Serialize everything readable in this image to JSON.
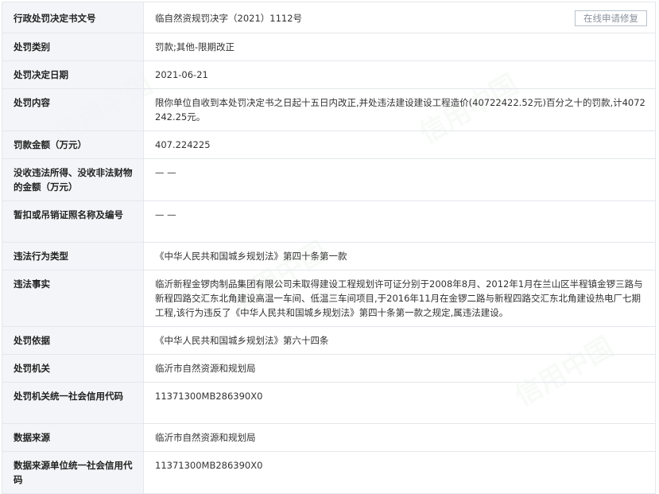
{
  "actions": {
    "fix_button": "在线申请修复"
  },
  "rows": [
    {
      "label": "行政处罚决定书文号",
      "value": "临自然资规罚决字（2021）1112号"
    },
    {
      "label": "处罚类别",
      "value": "罚款;其他-限期改正"
    },
    {
      "label": "处罚决定日期",
      "value": "2021-06-21"
    },
    {
      "label": "处罚内容",
      "value": "限你单位自收到本处罚决定书之日起十五日内改正,并处违法建设建设工程造价(40722422.52元)百分之十的罚款,计4072242.25元。"
    },
    {
      "label": "罚款金额（万元）",
      "value": "407.224225"
    },
    {
      "label": "没收违法所得、没收非法财物的金额（万元）",
      "value": "— —"
    },
    {
      "label": "暂扣或吊销证照名称及编号",
      "value": "— —"
    },
    {
      "label": "违法行为类型",
      "value": "《中华人民共和国城乡规划法》第四十条第一款"
    },
    {
      "label": "违法事实",
      "value": "临沂新程金锣肉制品集团有限公司未取得建设工程规划许可证分别于2008年8月、2012年1月在兰山区半程镇金锣三路与新程四路交汇东北角建设高温一车间、低温三车间项目,于2016年11月在金锣二路与新程四路交汇东北角建设热电厂七期工程,该行为违反了《中华人民共和国城乡规划法》第四十条第一款之规定,属违法建设。"
    },
    {
      "label": "处罚依据",
      "value": "《中华人民共和国城乡规划法》第六十四条"
    },
    {
      "label": "处罚机关",
      "value": "临沂市自然资源和规划局"
    },
    {
      "label": "处罚机关统一社会信用代码",
      "value": "11371300MB286390X0"
    },
    {
      "label": "数据来源",
      "value": "临沂市自然资源和规划局"
    },
    {
      "label": "数据来源单位统一社会信用代码",
      "value": "11371300MB286390X0"
    }
  ]
}
